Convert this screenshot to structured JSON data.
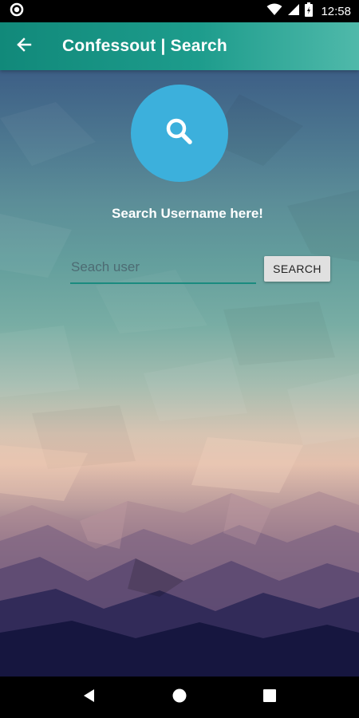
{
  "status_bar": {
    "time": "12:58",
    "icons": [
      "circle-notification-icon",
      "wifi-icon",
      "signal-icon",
      "battery-charging-icon"
    ]
  },
  "app_bar": {
    "title": "Confessout | Search",
    "back_icon": "arrow-back-icon",
    "gradient_colors": [
      "#11897a",
      "#4fb9aa"
    ]
  },
  "main": {
    "icon": "search-icon",
    "icon_circle_color": "#3cb0dc",
    "headline": "Search Username here!",
    "search_input": {
      "placeholder": "Seach user",
      "value": ""
    },
    "search_button_label": "SEARCH"
  },
  "nav_bar": {
    "icons": [
      "back-triangle-icon",
      "home-circle-icon",
      "recents-square-icon"
    ]
  }
}
